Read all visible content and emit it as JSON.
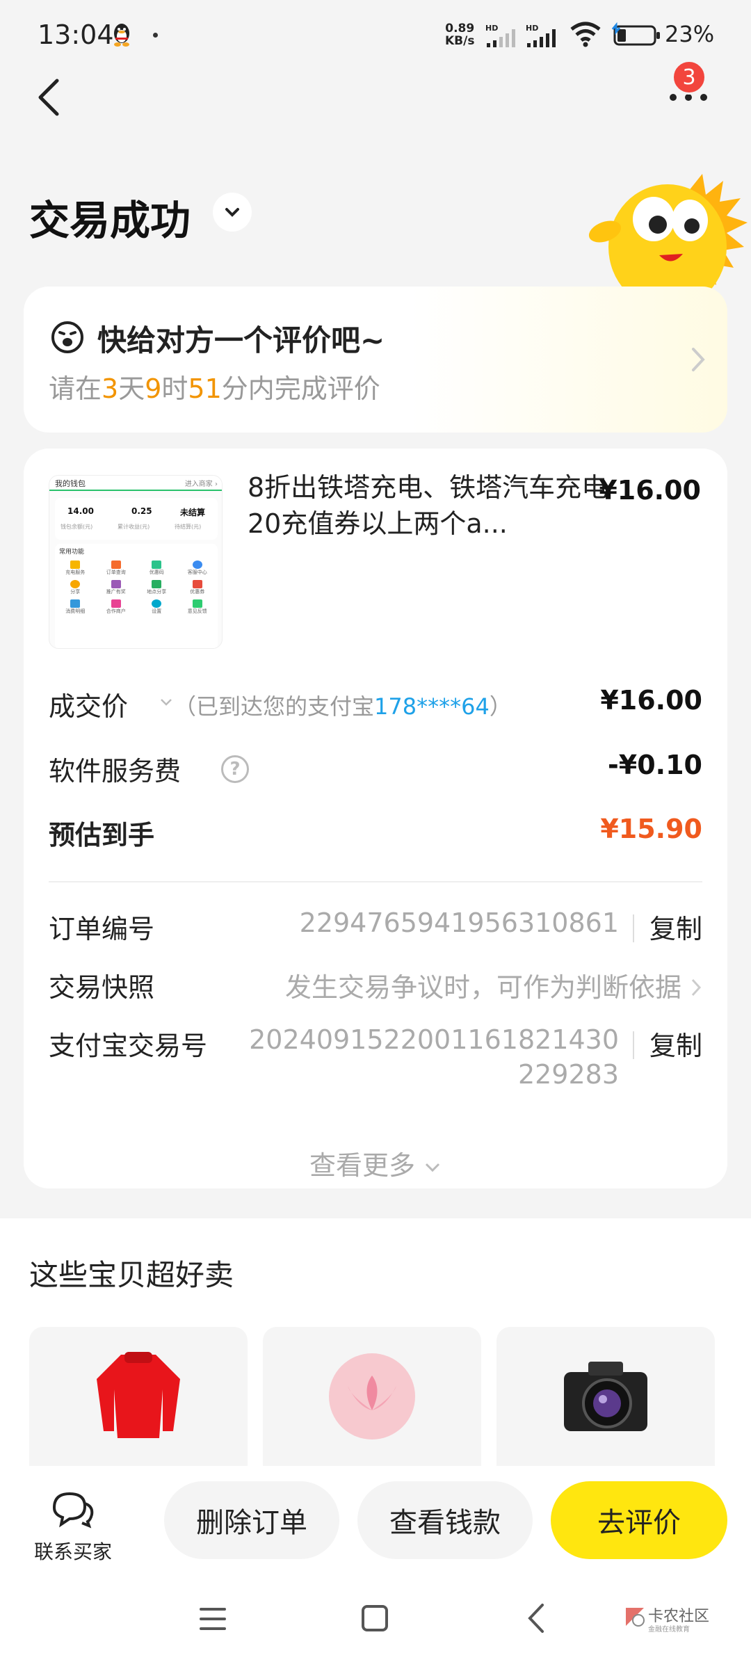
{
  "status_bar": {
    "time": "13:04",
    "net_speed": "0.89",
    "net_unit": "KB/s",
    "battery": "23%"
  },
  "nav": {
    "badge_count": "3"
  },
  "page_title": "交易成功",
  "review": {
    "title": "快给对方一个评价吧~",
    "sub_prefix": "请在",
    "days": "3",
    "days_unit": "天",
    "hours": "9",
    "hours_unit": "时",
    "minutes": "51",
    "minutes_unit": "分内完成评价"
  },
  "order": {
    "product_title": "8折出铁塔充电、铁塔汽车充电 20充值券以上两个a...",
    "product_price": "¥16.00",
    "deal_label": "成交价",
    "deal_note_prefix": "（已到达您的支付宝",
    "deal_account": "178****64",
    "deal_note_suffix": "）",
    "deal_price": "¥16.00",
    "fee_label": "软件服务费",
    "fee_value": "-¥0.10",
    "estimate_label": "预估到手",
    "estimate_value": "¥15.90",
    "order_no_label": "订单编号",
    "order_no": "2294765941956310861",
    "copy_label": "复制",
    "snapshot_label": "交易快照",
    "snapshot_value": "发生交易争议时，可作为判断依据",
    "alipay_label": "支付宝交易号",
    "alipay_no_line1": "2024091522001161821430",
    "alipay_no_line2": "229283",
    "see_more": "查看更多"
  },
  "thumbnail": {
    "header_left": "我的钱包",
    "header_right": "进入商家 ›",
    "stats": [
      "14.00",
      "0.25",
      "未结算"
    ],
    "stat_labels": [
      "钱包余额(元)",
      "累计收益(元)",
      "待结算(元)"
    ],
    "section": "常用功能",
    "grid": [
      "充电服务",
      "订单查询",
      "优惠码",
      "客服中心",
      "分享",
      "推广有奖",
      "地点分享",
      "优惠券",
      "消费明细",
      "合作商户",
      "设置",
      "意见反馈"
    ]
  },
  "recommend": {
    "title": "这些宝贝超好卖"
  },
  "bottom_bar": {
    "contact_label": "联系买家",
    "delete_label": "删除订单",
    "view_money_label": "查看钱款",
    "review_label": "去评价"
  },
  "watermark": {
    "text": "卡农社区",
    "sub": "金融在线教育"
  },
  "colors": {
    "accent_yellow": "#ffe60f",
    "highlight_orange": "#f29400",
    "price_red": "#f05a1e",
    "link_blue": "#1ea1e8",
    "badge_red": "#f2453d"
  }
}
